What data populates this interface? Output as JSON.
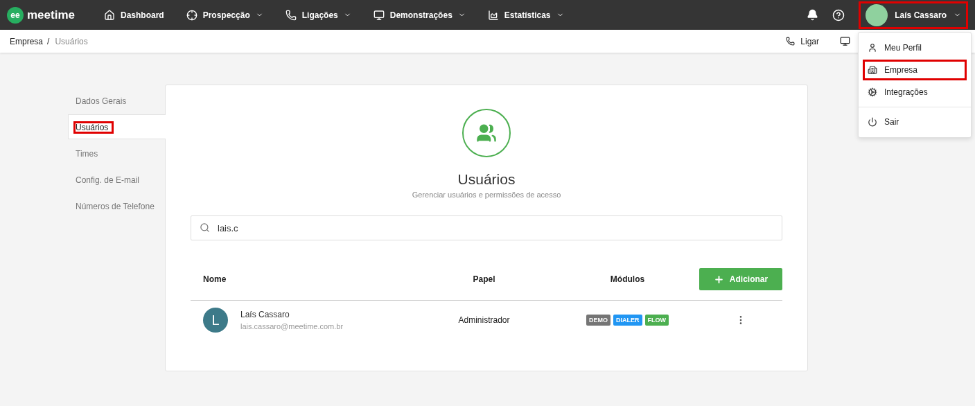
{
  "brand": {
    "name": "meetime",
    "mark": "ee"
  },
  "nav": [
    {
      "label": "Dashboard",
      "dropdown": false
    },
    {
      "label": "Prospecção",
      "dropdown": true
    },
    {
      "label": "Ligações",
      "dropdown": true
    },
    {
      "label": "Demonstrações",
      "dropdown": true
    },
    {
      "label": "Estatísticas",
      "dropdown": true
    }
  ],
  "user_menu": {
    "name": "Laís Cassaro",
    "highlighted": true,
    "expanded": true
  },
  "breadcrumb": [
    {
      "label": "Empresa",
      "current": false
    },
    {
      "label": "Usuários",
      "current": true
    }
  ],
  "breadcrumb_separator": "/",
  "quick_actions": [
    {
      "label": "Ligar"
    }
  ],
  "dropdown": [
    {
      "label": "Meu Perfil",
      "highlighted": false,
      "divider_before": false
    },
    {
      "label": "Empresa",
      "highlighted": true,
      "divider_before": false
    },
    {
      "label": "Integrações",
      "highlighted": false,
      "divider_before": false
    },
    {
      "label": "Sair",
      "highlighted": false,
      "divider_before": true
    }
  ],
  "sidebar": [
    {
      "label": "Dados Gerais",
      "selected": false,
      "highlighted": false
    },
    {
      "label": "Usuários",
      "selected": true,
      "highlighted": true
    },
    {
      "label": "Times",
      "selected": false,
      "highlighted": false
    },
    {
      "label": "Config. de E-mail",
      "selected": false,
      "highlighted": false
    },
    {
      "label": "Números de Telefone",
      "selected": false,
      "highlighted": false
    }
  ],
  "page": {
    "title": "Usuários",
    "subtitle": "Gerenciar usuários e permissões de acesso"
  },
  "search": {
    "value": "lais.c"
  },
  "table": {
    "columns": [
      "Nome",
      "Papel",
      "Módulos"
    ],
    "add_button": "Adicionar",
    "rows": [
      {
        "initial": "L",
        "name": "Laís Cassaro",
        "email": "lais.cassaro@meetime.com.br",
        "role": "Administrador",
        "modules": [
          {
            "label": "DEMO",
            "color": "#757575"
          },
          {
            "label": "DIALER",
            "color": "#2196f3"
          },
          {
            "label": "FLOW",
            "color": "#4caf50"
          }
        ]
      }
    ]
  }
}
